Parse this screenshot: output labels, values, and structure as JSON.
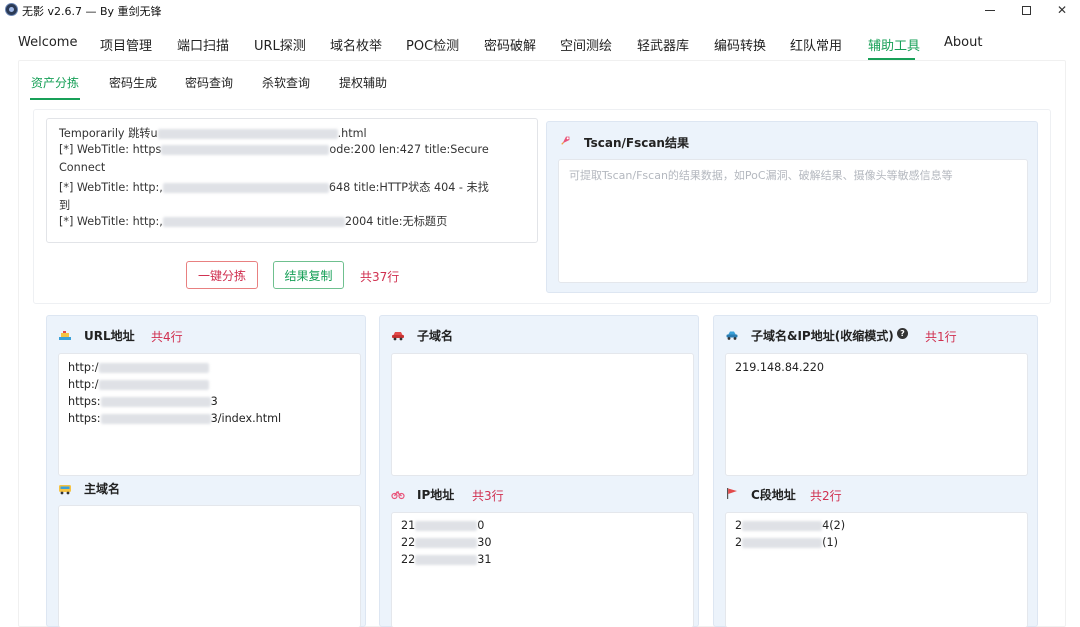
{
  "window": {
    "title": "无影 v2.6.7 — By 重剑无锋",
    "minimize": "—",
    "maximize": "□",
    "close": "✕"
  },
  "main_tabs": [
    {
      "label": "Welcome"
    },
    {
      "label": "项目管理"
    },
    {
      "label": "端口扫描"
    },
    {
      "label": "URL探测"
    },
    {
      "label": "域名枚举"
    },
    {
      "label": "POC检测"
    },
    {
      "label": "密码破解"
    },
    {
      "label": "空间测绘"
    },
    {
      "label": "轻武器库"
    },
    {
      "label": "编码转换"
    },
    {
      "label": "红队常用"
    },
    {
      "label": "辅助工具"
    },
    {
      "label": "About"
    }
  ],
  "active_main_tab": "辅助工具",
  "sub_tabs": [
    {
      "label": "资产分拣"
    },
    {
      "label": "密码生成"
    },
    {
      "label": "密码查询"
    },
    {
      "label": "杀软查询"
    },
    {
      "label": "提权辅助"
    }
  ],
  "active_sub_tab": "资产分拣",
  "log": {
    "lines": [
      {
        "prefix": "Temporarily 跳转u",
        "suffix": ".html"
      },
      {
        "prefix": "[*] WebTitle: https",
        "suffix": "ode:200 len:427    title:Secure"
      },
      {
        "prefix": "Connect",
        "suffix": ""
      },
      {
        "prefix": "[*] WebTitle: http:,",
        "suffix": "648     title:HTTP状态 404 - 未找"
      },
      {
        "prefix": "到",
        "suffix": ""
      },
      {
        "prefix": "[*] WebTitle: http:,",
        "suffix": "2004   title:无标题页"
      }
    ]
  },
  "actions": {
    "sort_button": "一键分拣",
    "copy_button": "结果复制",
    "line_count": "共37行"
  },
  "tscan": {
    "title": "Tscan/Fscan结果",
    "placeholder": "可提取Tscan/Fscan的结果数据，如PoC漏洞、破解结果、摄像头等敏感信息等"
  },
  "url_panel": {
    "title": "URL地址",
    "count": "共4行",
    "entries": [
      {
        "prefix": "http:/",
        "suffix": ""
      },
      {
        "prefix": "http:/",
        "suffix": ""
      },
      {
        "prefix": "https:",
        "suffix": "3"
      },
      {
        "prefix": "https:",
        "suffix": "3/index.html"
      }
    ]
  },
  "main_domain_panel": {
    "title": "主域名"
  },
  "subdomain_panel": {
    "title": "子域名"
  },
  "ip_panel": {
    "title": "IP地址",
    "count": "共3行",
    "entries": [
      {
        "prefix": "21",
        "suffix": "0"
      },
      {
        "prefix": "22",
        "suffix": "30"
      },
      {
        "prefix": "22",
        "suffix": "31"
      }
    ]
  },
  "subdomain_ip_panel": {
    "title": "子域名&IP地址(收缩模式)",
    "help": "?",
    "count": "共1行",
    "entries": [
      "219.148.84.220"
    ]
  },
  "c_segment_panel": {
    "title": "C段地址",
    "count": "共2行",
    "entries": [
      {
        "prefix": "2",
        "suffix": "4(2)"
      },
      {
        "prefix": "2",
        "suffix": "(1)"
      }
    ]
  },
  "colors": {
    "accent": "#18a058",
    "danger": "#d03050",
    "panel_bg": "#ecf3fb"
  },
  "icons": {
    "rocket": "rocket-icon",
    "ship": "ship-icon",
    "car": "car-icon",
    "bus": "bus-icon",
    "bike": "bicycle-icon",
    "flag": "flag-icon",
    "cloud": "cloud-car-icon"
  }
}
